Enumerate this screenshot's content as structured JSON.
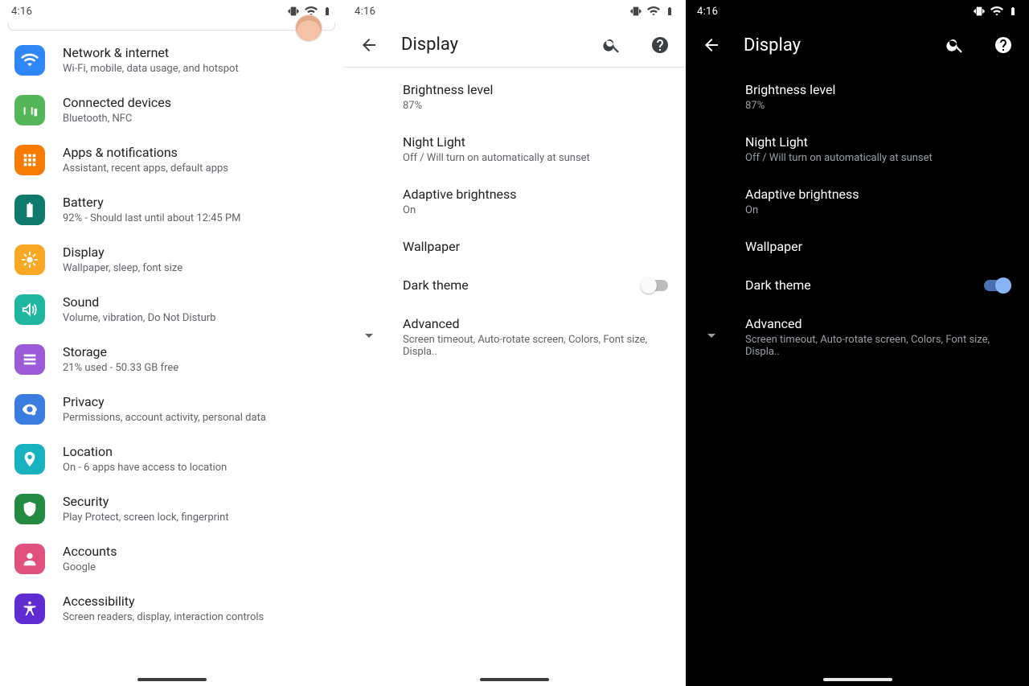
{
  "status": {
    "time": "4:16"
  },
  "panel1": {
    "items": [
      {
        "name": "network-internet",
        "title": "Network & internet",
        "subtitle": "Wi-Fi, mobile, data usage, and hotspot",
        "icon": "wifi",
        "color": "#2f86f6"
      },
      {
        "name": "connected-devices",
        "title": "Connected devices",
        "subtitle": "Bluetooth, NFC",
        "icon": "devices",
        "color": "#54b658"
      },
      {
        "name": "apps-notifications",
        "title": "Apps & notifications",
        "subtitle": "Assistant, recent apps, default apps",
        "icon": "apps",
        "color": "#f57c00"
      },
      {
        "name": "battery",
        "title": "Battery",
        "subtitle": "92% - Should last until about 12:45 PM",
        "icon": "battery",
        "color": "#0f7a6b"
      },
      {
        "name": "display",
        "title": "Display",
        "subtitle": "Wallpaper, sleep, font size",
        "icon": "brightness",
        "color": "#f9a825"
      },
      {
        "name": "sound",
        "title": "Sound",
        "subtitle": "Volume, vibration, Do Not Disturb",
        "icon": "sound",
        "color": "#1fb6a0"
      },
      {
        "name": "storage",
        "title": "Storage",
        "subtitle": "21% used - 50.33 GB free",
        "icon": "storage",
        "color": "#9b5ad6"
      },
      {
        "name": "privacy",
        "title": "Privacy",
        "subtitle": "Permissions, account activity, personal data",
        "icon": "privacy",
        "color": "#3a7ce0"
      },
      {
        "name": "location",
        "title": "Location",
        "subtitle": "On - 6 apps have access to location",
        "icon": "location",
        "color": "#17b1bf"
      },
      {
        "name": "security",
        "title": "Security",
        "subtitle": "Play Protect, screen lock, fingerprint",
        "icon": "security",
        "color": "#228a41"
      },
      {
        "name": "accounts",
        "title": "Accounts",
        "subtitle": "Google",
        "icon": "accounts",
        "color": "#e0517e"
      },
      {
        "name": "accessibility",
        "title": "Accessibility",
        "subtitle": "Screen readers, display, interaction controls",
        "icon": "accessibility",
        "color": "#5f2bd2"
      }
    ]
  },
  "display": {
    "header": "Display",
    "items": [
      {
        "key": "brightness",
        "title": "Brightness level",
        "subtitle": "87%"
      },
      {
        "key": "nightlight",
        "title": "Night Light",
        "subtitle": "Off / Will turn on automatically at sunset"
      },
      {
        "key": "adaptive",
        "title": "Adaptive brightness",
        "subtitle": "On"
      },
      {
        "key": "wallpaper",
        "title": "Wallpaper",
        "subtitle": ""
      },
      {
        "key": "darktheme",
        "title": "Dark theme",
        "subtitle": "",
        "switch": true
      },
      {
        "key": "advanced",
        "title": "Advanced",
        "subtitle": "Screen timeout, Auto-rotate screen, Colors, Font size, Displa..",
        "chevron": true
      }
    ],
    "dark_theme_state": {
      "panel2": "off",
      "panel3": "on"
    }
  }
}
